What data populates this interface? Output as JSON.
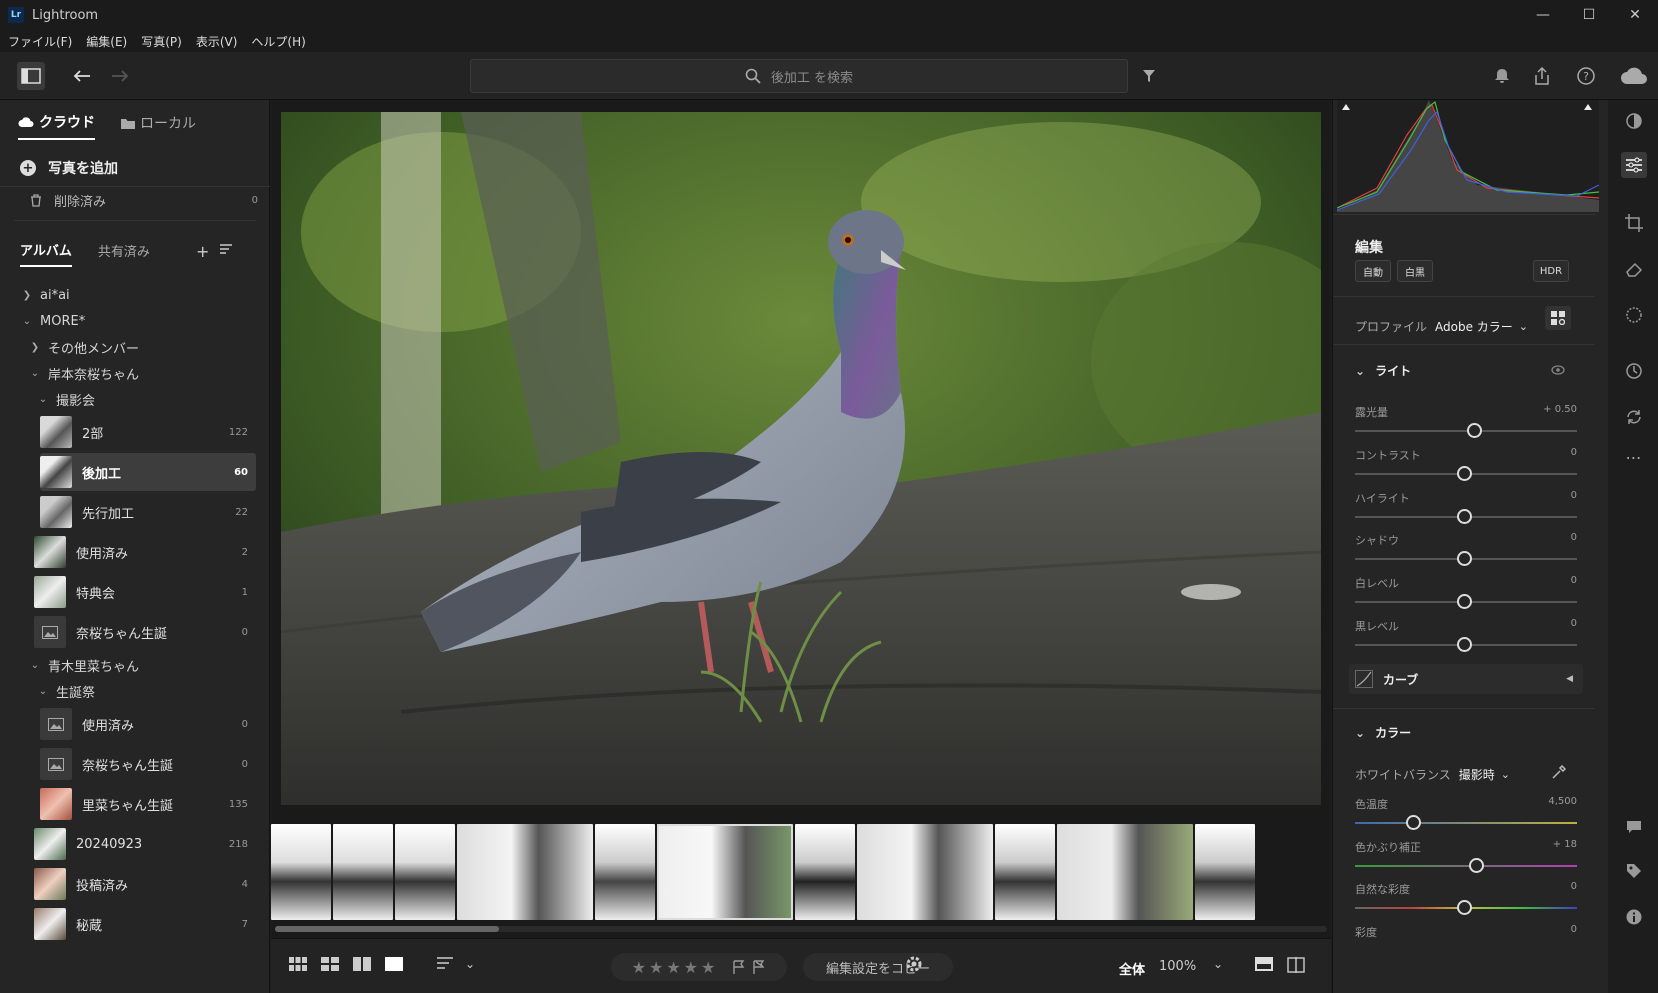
{
  "window": {
    "app_icon": "Lr",
    "title": "Lightroom",
    "controls": [
      "minimize",
      "maximize",
      "close"
    ]
  },
  "menu": [
    "ファイル(F)",
    "編集(E)",
    "写真(P)",
    "表示(V)",
    "ヘルプ(H)"
  ],
  "search": {
    "placeholder": "後加工 を検索"
  },
  "left": {
    "tabs": {
      "cloud": "クラウド",
      "local": "ローカル"
    },
    "add_photos": "写真を追加",
    "trash": {
      "label": "削除済み",
      "count": "0"
    },
    "album_tabs": {
      "albums": "アルバム",
      "shared": "共有済み"
    },
    "tree": {
      "aiai": "ai*ai",
      "more": "MORE*",
      "others": "その他メンバー",
      "kishimoto": "岸本奈桜ちゃん",
      "satsueikai": "撮影会",
      "aoki": "青木里菜ちゃん",
      "tanjousai": "生誕祭"
    },
    "albums": [
      {
        "label": "2部",
        "count": "122"
      },
      {
        "label": "後加工",
        "count": "60"
      },
      {
        "label": "先行加工",
        "count": "22"
      },
      {
        "label": "使用済み",
        "count": "2"
      },
      {
        "label": "特典会",
        "count": "1"
      },
      {
        "label": "奈桜ちゃん生誕",
        "count": "0"
      },
      {
        "label": "使用済み",
        "count": "0"
      },
      {
        "label": "奈桜ちゃん生誕",
        "count": "0"
      },
      {
        "label": "里菜ちゃん生誕",
        "count": "135"
      },
      {
        "label": "20240923",
        "count": "218"
      },
      {
        "label": "投稿済み",
        "count": "4"
      },
      {
        "label": "秘蔵",
        "count": "7"
      }
    ]
  },
  "bottom": {
    "copy_edit": "編集設定をコピー",
    "fit": "全体",
    "zoom": "100%",
    "stars": "★★★★★"
  },
  "right": {
    "edit_title": "編集",
    "auto": "自動",
    "bw": "白黒",
    "hdr": "HDR",
    "profile_label": "プロファイル",
    "profile_value": "Adobe カラー",
    "light_section": "ライト",
    "sliders_light": [
      {
        "label": "露光量",
        "value": "+ 0.50"
      },
      {
        "label": "コントラスト",
        "value": "0"
      },
      {
        "label": "ハイライト",
        "value": "0"
      },
      {
        "label": "シャドウ",
        "value": "0"
      },
      {
        "label": "白レベル",
        "value": "0"
      },
      {
        "label": "黒レベル",
        "value": "0"
      }
    ],
    "curve": "カーブ",
    "color_section": "カラー",
    "wb_label": "ホワイトバランス",
    "wb_value": "撮影時",
    "sliders_color": [
      {
        "label": "色温度",
        "value": "4,500"
      },
      {
        "label": "色かぶり補正",
        "value": "+ 18"
      },
      {
        "label": "自然な彩度",
        "value": "0"
      },
      {
        "label": "彩度",
        "value": "0"
      }
    ]
  },
  "colors": {
    "accent": "#ffffff",
    "panel": "#252525",
    "background": "#1a1a1a"
  }
}
